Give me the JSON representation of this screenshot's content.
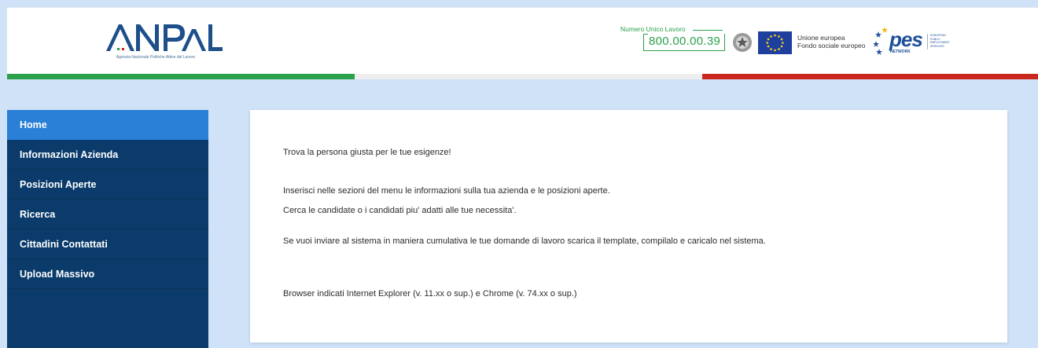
{
  "header": {
    "logo_text": "ANPAL",
    "logo_subtitle": "Agenzia Nazionale Politiche Attive del Lavoro",
    "numero_label": "Numero Unico Lavoro",
    "numero_value": "800.00.00.39",
    "eu_line1": "Unione europea",
    "eu_line2": "Fondo sociale europeo",
    "pes_word": "pes",
    "pes_network": "NETWORK",
    "pes_side": [
      "EUROPEAN",
      "PUBLIC",
      "EMPLOYMENT",
      "SERVICES"
    ],
    "stripe_colors": {
      "green": "#2aa14a",
      "white": "#eeeeee",
      "red": "#c9271e"
    }
  },
  "sidebar": {
    "items": [
      {
        "label": "Home",
        "active": true
      },
      {
        "label": "Informazioni Azienda",
        "active": false
      },
      {
        "label": "Posizioni Aperte",
        "active": false
      },
      {
        "label": "Ricerca",
        "active": false
      },
      {
        "label": "Cittadini Contattati",
        "active": false
      },
      {
        "label": "Upload Massivo",
        "active": false
      }
    ]
  },
  "content": {
    "intro": "Trova la persona giusta per le tue esigenze!",
    "line1": "Inserisci nelle sezioni del menu le informazioni sulla tua azienda e le posizioni aperte.",
    "line2": "Cerca le candidate o i candidati piu' adatti alle tue necessita'.",
    "line3": "Se vuoi inviare al sistema in maniera cumulativa le tue domande di lavoro scarica il template, compilalo e caricalo nel sistema.",
    "browser_note": "Browser indicati Internet Explorer (v. 11.xx o sup.) e Chrome (v. 74.xx o sup.)"
  },
  "colors": {
    "page_bg": "#cfe2f7",
    "sidebar_bg": "#0a3b6b",
    "sidebar_active": "#2a7fd6",
    "accent_green": "#2aa14a"
  }
}
